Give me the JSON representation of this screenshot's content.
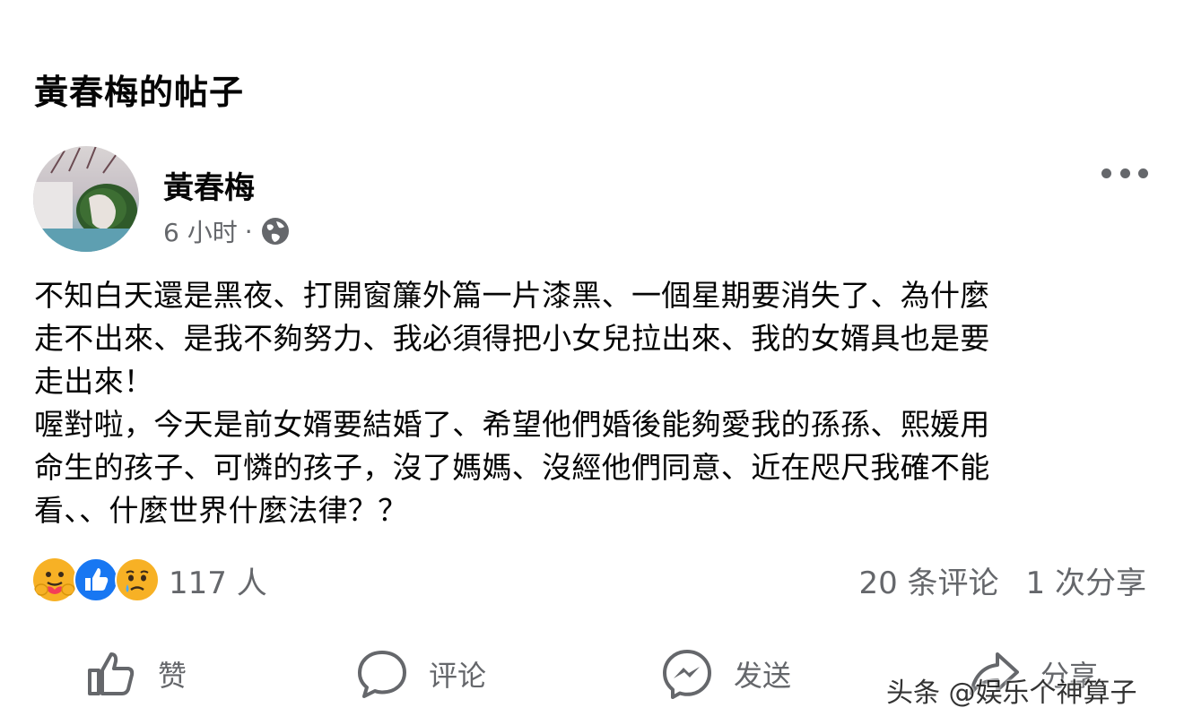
{
  "page": {
    "title": "黃春梅的帖子"
  },
  "post": {
    "author": "黃春梅",
    "time": "6 小时",
    "separator": "·",
    "audience_icon": "globe-icon",
    "body": "不知白天還是黑夜、打開窗簾外篇一片漆黑、一個星期要消失了、為什麼\n走不出來、是我不夠努力、我必須得把小女兒拉出來、我的女婿具也是要\n走出來！\n喔對啦，今天是前女婿要結婚了、希望他們婚後能夠愛我的孫孫、熙媛用\n命生的孩子、可憐的孩子，沒了媽媽、沒經他們同意、近在咫尺我確不能\n看、、什麼世界什麼法律？？",
    "more_icon": "more-options-icon"
  },
  "reactions": {
    "icons": [
      "care-reaction-icon",
      "like-reaction-icon",
      "sad-reaction-icon"
    ],
    "count": "117 人"
  },
  "stats": {
    "comments": "20 条评论",
    "shares": "1 次分享"
  },
  "actions": {
    "like": "赞",
    "comment": "评论",
    "send": "发送",
    "share": "分享"
  },
  "watermark": "头条 @娱乐个神算子",
  "colors": {
    "text": "#050505",
    "secondary": "#65676b",
    "like_blue": "#1877f2",
    "emoji_yellow": "#f7b125"
  }
}
